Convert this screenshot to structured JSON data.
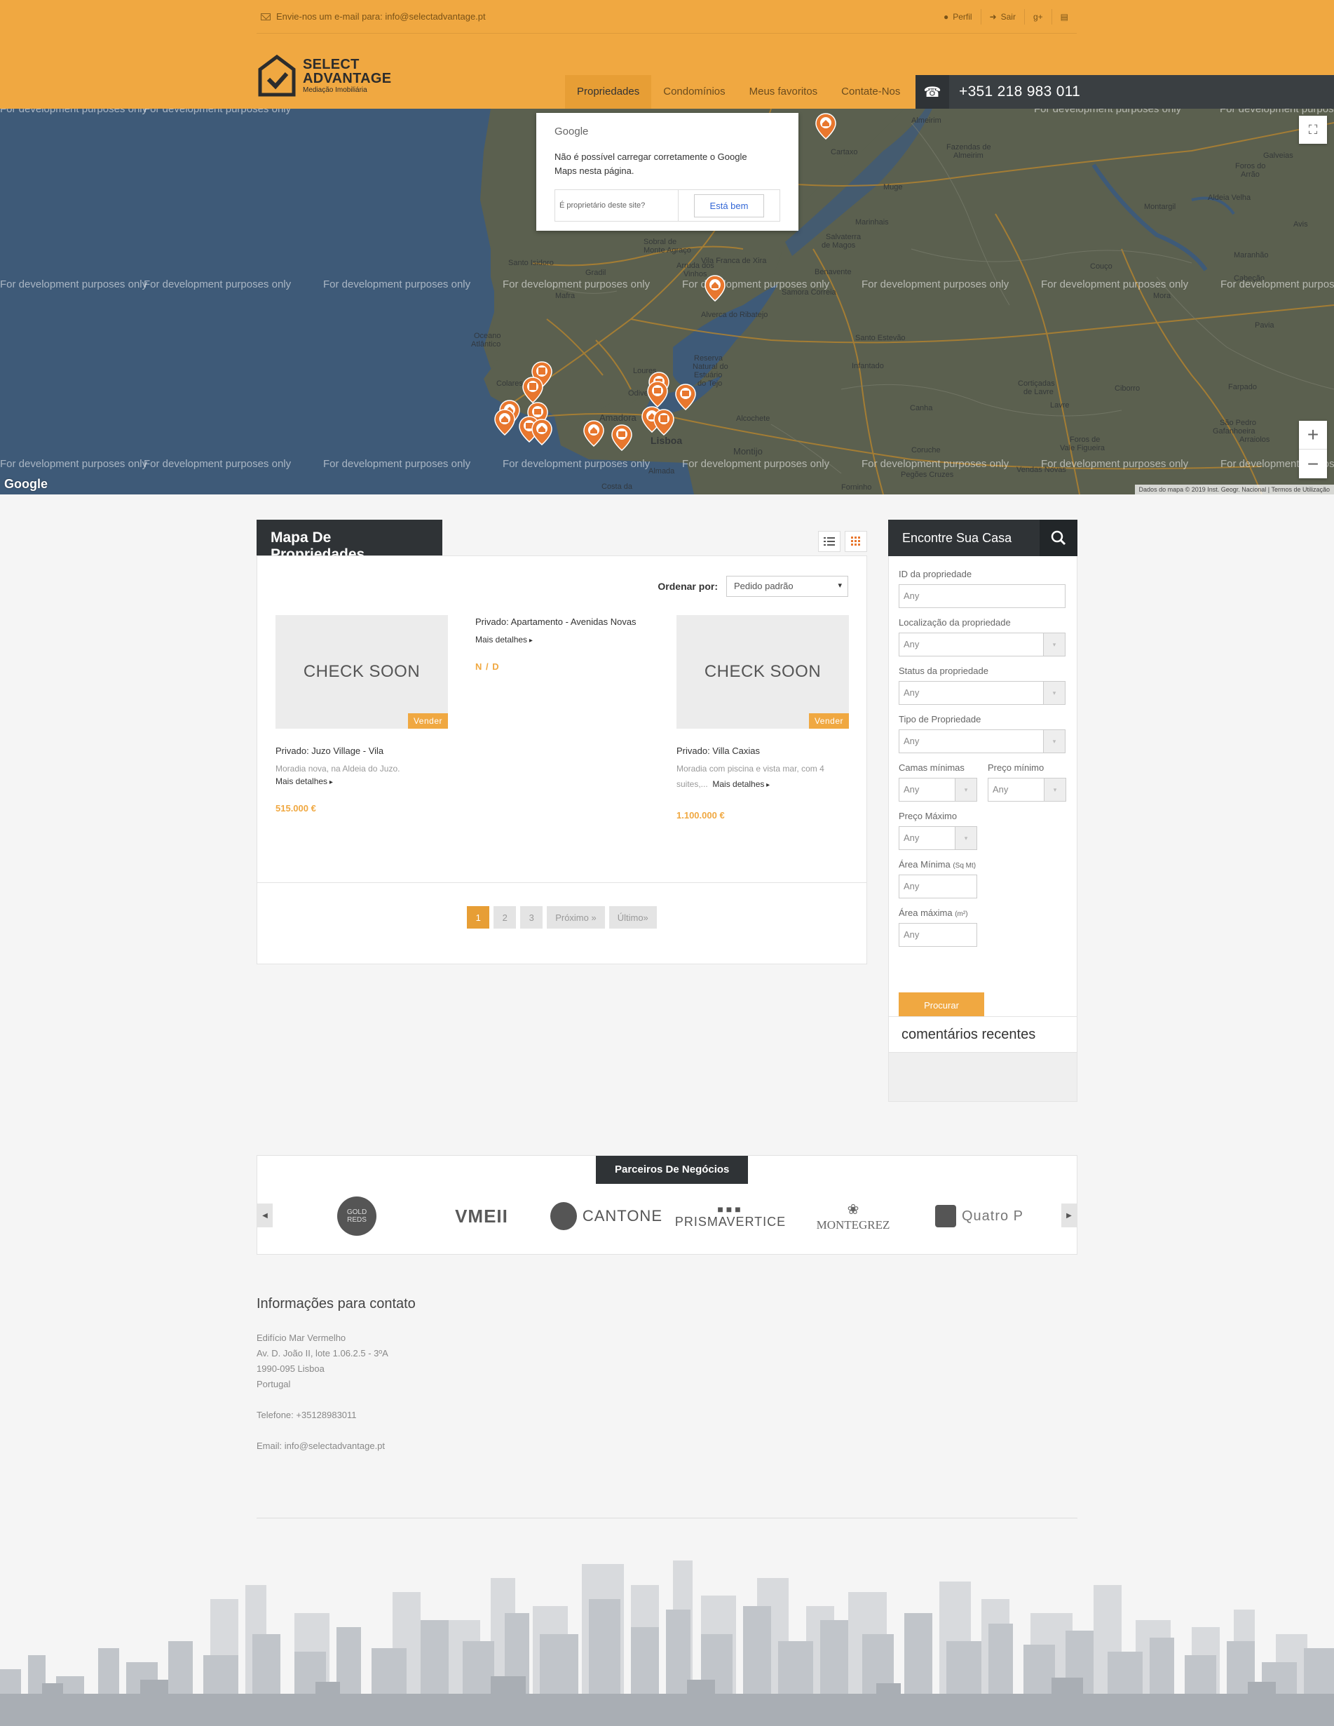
{
  "topbar": {
    "email_label": "Envie-nos um e-mail para: info@selectadvantage.pt",
    "profile": "Perfil",
    "logout": "Sair"
  },
  "logo": {
    "line1": "SELECT",
    "line2": "ADVANTAGE",
    "line3": "Mediação Imobiliária"
  },
  "nav": [
    {
      "label": "Propriedades",
      "active": true
    },
    {
      "label": "Condomínios"
    },
    {
      "label": "Meus favoritos"
    },
    {
      "label": "Contate-Nos"
    }
  ],
  "phone": "+351 218 983 011",
  "map": {
    "watermark": "For development purposes only",
    "dialog_brand": "Google",
    "dialog_message": "Não é possível carregar corretamente o Google Maps nesta página.",
    "dialog_question": "É proprietário deste site?",
    "dialog_ok": "Está bem",
    "footer": "Dados do mapa © 2019 Inst. Geogr. Nacional | Termos de Utilização",
    "google_logo": "Google",
    "place_labels": [
      "Almeirim",
      "Fazendas de Almeirim",
      "Cartaxo",
      "Muge",
      "Marinhais",
      "Salvaterra de Magos",
      "Benavente",
      "Santo Isidoro",
      "Mafra",
      "Vila Franca de Xira",
      "Alverca do Ribatejo",
      "Samora Correia",
      "Santo Estevão",
      "Infantado",
      "Loures",
      "Amadora",
      "Lisboa",
      "Montijo",
      "Alcochete",
      "Coruche",
      "Mora",
      "Pavia",
      "Montargil",
      "Couço",
      "Ciborro",
      "Lavre",
      "Canha",
      "Vendas Novas",
      "Cortiçadas de Lavre",
      "Foros de Vale Figueira",
      "Pegões Cruzes",
      "Sobral de Monte Agraço",
      "Arruda dos Vinhos",
      "Gradil",
      "Colares",
      "Oceano Atlântico",
      "Reserva Natural do Estuário do Tejo",
      "Galveias",
      "Foros do Arrão",
      "Aldeia Velha",
      "Avis",
      "Maranhão",
      "Cabeção",
      "Farpado",
      "São Pedro Gafanhoeira",
      "Arraiolos",
      "Odivelas",
      "Costa da",
      "Almada",
      "Forninho"
    ]
  },
  "listing": {
    "title": "Mapa De Propriedades",
    "sort_label": "Ordenar por:",
    "sort_value": "Pedido padrão",
    "cards": [
      {
        "image_text": "CHECK SOON",
        "badge": "Vender",
        "title": "Privado: Juzo Village - Vila",
        "desc": "Moradia nova, na Aldeia do Juzo.",
        "more": "Mais detalhes",
        "price": "515.000 €"
      },
      {
        "title": "Privado: Apartamento - Avenidas Novas",
        "more": "Mais detalhes",
        "price": "N / D"
      },
      {
        "image_text": "CHECK SOON",
        "badge": "Vender",
        "title": "Privado: Villa Caxias",
        "desc": "Moradia com piscina e vista mar, com 4 suites,...",
        "more": "Mais detalhes",
        "price": "1.100.000 €"
      }
    ],
    "pages": [
      "1",
      "2",
      "3",
      "Próximo »",
      "Último»"
    ]
  },
  "search": {
    "title": "Encontre Sua Casa",
    "id_label": "ID da propriedade",
    "location_label": "Localização da propriedade",
    "status_label": "Status da propriedade",
    "type_label": "Tipo de Propriedade",
    "beds_label": "Camas mínimas",
    "minprice_label": "Preço mínimo",
    "maxprice_label": "Preço Máximo",
    "minarea_label": "Área Mínima",
    "minarea_unit": "(Sq Mt)",
    "maxarea_label": "Área máxima",
    "maxarea_unit": "(m²)",
    "any": "Any",
    "button": "Procurar"
  },
  "recent": {
    "title": "comentários recentes"
  },
  "partners": {
    "title": "Parceiros De Negócios",
    "logos": [
      "GOLD REDS",
      "VMEII",
      "CANTONE",
      "PRISMAVERTICE",
      "MONTEGREZ",
      "Quatro P"
    ]
  },
  "contact": {
    "title": "Informações para contato",
    "address": [
      "Edifício Mar Vermelho",
      "Av. D. João II, lote 1.06.2.5 - 3ºA",
      "1990-095 Lisboa",
      "Portugal"
    ],
    "phone": "Telefone: +35128983011",
    "email": "Email: info@selectadvantage.pt"
  },
  "colors": {
    "accent": "#f0a841",
    "dark": "#2f3336",
    "map_water": "#3e5a78",
    "map_land": "#5a5f4e"
  }
}
